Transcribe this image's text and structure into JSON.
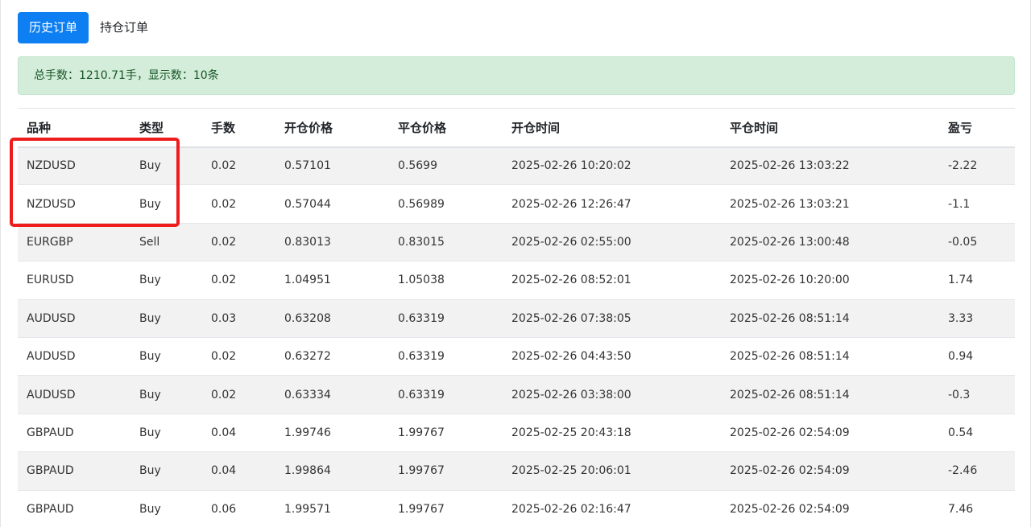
{
  "tabs": {
    "history_label": "历史订单",
    "positions_label": "持仓订单"
  },
  "summary": {
    "text": "总手数：1210.71手，显示数：10条"
  },
  "table": {
    "headers": [
      "品种",
      "类型",
      "手数",
      "开仓价格",
      "平仓价格",
      "开仓时间",
      "平仓时间",
      "盈亏"
    ],
    "rows": [
      [
        "NZDUSD",
        "Buy",
        "0.02",
        "0.57101",
        "0.5699",
        "2025-02-26 10:20:02",
        "2025-02-26 13:03:22",
        "-2.22"
      ],
      [
        "NZDUSD",
        "Buy",
        "0.02",
        "0.57044",
        "0.56989",
        "2025-02-26 12:26:47",
        "2025-02-26 13:03:21",
        "-1.1"
      ],
      [
        "EURGBP",
        "Sell",
        "0.02",
        "0.83013",
        "0.83015",
        "2025-02-26 02:55:00",
        "2025-02-26 13:00:48",
        "-0.05"
      ],
      [
        "EURUSD",
        "Buy",
        "0.02",
        "1.04951",
        "1.05038",
        "2025-02-26 08:52:01",
        "2025-02-26 10:20:00",
        "1.74"
      ],
      [
        "AUDUSD",
        "Buy",
        "0.03",
        "0.63208",
        "0.63319",
        "2025-02-26 07:38:05",
        "2025-02-26 08:51:14",
        "3.33"
      ],
      [
        "AUDUSD",
        "Buy",
        "0.02",
        "0.63272",
        "0.63319",
        "2025-02-26 04:43:50",
        "2025-02-26 08:51:14",
        "0.94"
      ],
      [
        "AUDUSD",
        "Buy",
        "0.02",
        "0.63334",
        "0.63319",
        "2025-02-26 03:38:00",
        "2025-02-26 08:51:14",
        "-0.3"
      ],
      [
        "GBPAUD",
        "Buy",
        "0.04",
        "1.99746",
        "1.99767",
        "2025-02-25 20:43:18",
        "2025-02-26 02:54:09",
        "0.54"
      ],
      [
        "GBPAUD",
        "Buy",
        "0.04",
        "1.99864",
        "1.99767",
        "2025-02-25 20:06:01",
        "2025-02-26 02:54:09",
        "-2.46"
      ],
      [
        "GBPAUD",
        "Buy",
        "0.06",
        "1.99571",
        "1.99767",
        "2025-02-26 02:16:47",
        "2025-02-26 02:54:09",
        "7.46"
      ]
    ]
  },
  "colors": {
    "active_tab": "#0d7ff2",
    "alert_bg": "#d4ecda",
    "alert_text": "#155724",
    "highlight_box": "#ee1c1c"
  }
}
